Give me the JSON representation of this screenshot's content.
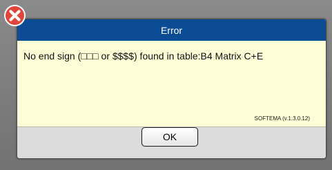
{
  "dialog": {
    "title": "Error",
    "message": "No end sign (□□□ or $$$$)  found in table:B4  Matrix  C+E",
    "version": "SOFTEMA  (v.1.3.0.12)",
    "ok_label": "OK"
  },
  "icons": {
    "close": "close-icon"
  },
  "colors": {
    "titlebar": "#0b4c94",
    "message_background": "#ffffd7",
    "close_icon": "#e0453a"
  }
}
